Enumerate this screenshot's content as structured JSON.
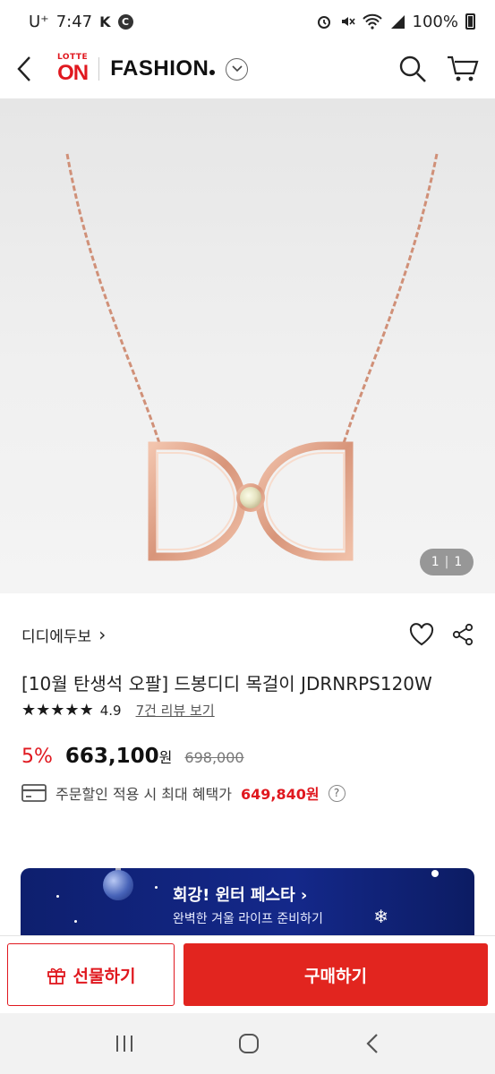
{
  "status_bar": {
    "carrier": "U⁺",
    "time": "7:47",
    "battery": "100%",
    "icons": [
      "k-icon",
      "c-icon",
      "alarm-icon",
      "mute-icon",
      "wifi-icon",
      "signal-icon",
      "battery-icon"
    ]
  },
  "header": {
    "logo_top": "LOTTE",
    "logo_main": "ON",
    "brand": "FASHION",
    "icons": [
      "back-icon",
      "chevron-down-icon",
      "search-icon",
      "cart-icon"
    ]
  },
  "gallery": {
    "counter_current": "1",
    "counter_total": "1"
  },
  "product": {
    "brand_name": "디디에두보",
    "brand_arrow": "›",
    "title": "[10월 탄생석 오팔] 드봉디디 목걸이 JDRNRPS120W",
    "rating": "4.9",
    "rating_stars": 5,
    "review_link": "7건 리뷰 보기",
    "discount": "5%",
    "price": "663,100",
    "price_unit": "원",
    "original_price": "698,000",
    "benefit_label": "주문할인 적용 시 최대 혜택가",
    "benefit_price": "649,840원",
    "help": "?"
  },
  "banner": {
    "title": "회강! 윈터 페스타 ›",
    "subtitle": "완벽한 겨울 라이프 준비하기"
  },
  "actions": {
    "gift_label": "선물하기",
    "buy_label": "구매하기"
  },
  "colors": {
    "accent": "#e0181f",
    "banner_bg": "#14288a"
  }
}
